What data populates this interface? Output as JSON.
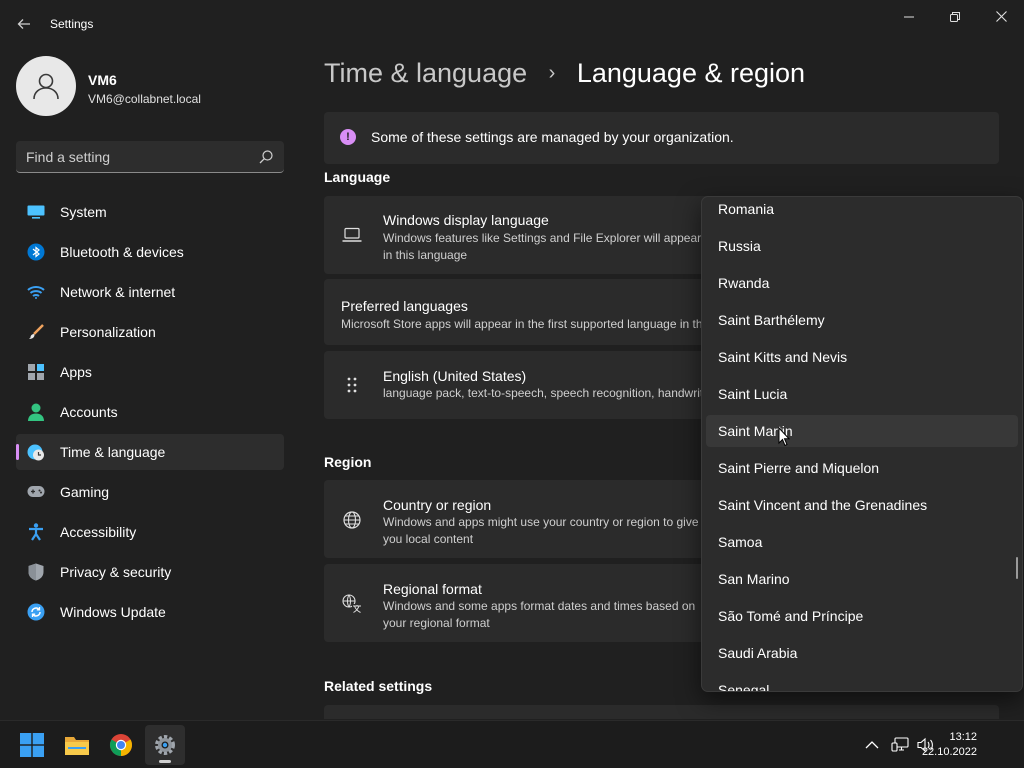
{
  "window": {
    "title": "Settings"
  },
  "profile": {
    "name": "VM6",
    "email": "VM6@collabnet.local"
  },
  "search": {
    "placeholder": "Find a setting"
  },
  "sidebar": {
    "items": [
      {
        "label": "System",
        "icon": "system-icon",
        "color": "#4cc2ff"
      },
      {
        "label": "Bluetooth & devices",
        "icon": "bluetooth-icon",
        "color": "#0078d4"
      },
      {
        "label": "Network & internet",
        "icon": "wifi-icon",
        "color": "#3aa0f3"
      },
      {
        "label": "Personalization",
        "icon": "brush-icon",
        "color": "#f0a35e"
      },
      {
        "label": "Apps",
        "icon": "apps-icon",
        "color": "#a0a6ad"
      },
      {
        "label": "Accounts",
        "icon": "person-icon",
        "color": "#33c481"
      },
      {
        "label": "Time & language",
        "icon": "globe-clock-icon",
        "color": "#4cc2ff",
        "active": true
      },
      {
        "label": "Gaming",
        "icon": "gamepad-icon",
        "color": "#a0a6ad"
      },
      {
        "label": "Accessibility",
        "icon": "accessibility-icon",
        "color": "#3aa0f3"
      },
      {
        "label": "Privacy & security",
        "icon": "shield-icon",
        "color": "#a0a6ad"
      },
      {
        "label": "Windows Update",
        "icon": "update-icon",
        "color": "#3aa0f3"
      }
    ]
  },
  "header": {
    "parent": "Time & language",
    "separator": "›",
    "current": "Language & region"
  },
  "banner": {
    "icon_glyph": "!",
    "text": "Some of these settings are managed by your organization."
  },
  "language": {
    "section_title": "Language",
    "display_language": {
      "title": "Windows display language",
      "desc": "Windows features like Settings and File Explorer will appear in this language"
    },
    "preferred": {
      "title": "Preferred languages",
      "desc": "Microsoft Store apps will appear in the first supported language in this list"
    },
    "english": {
      "title": "English (United States)",
      "desc": "language pack, text-to-speech, speech recognition, handwriting, basic typing"
    }
  },
  "region": {
    "section_title": "Region",
    "country": {
      "title": "Country or region",
      "desc": "Windows and apps might use your country or region to give you local content"
    },
    "format": {
      "title": "Regional format",
      "desc": "Windows and some apps format dates and times based on your regional format"
    }
  },
  "related": {
    "section_title": "Related settings"
  },
  "dropdown": {
    "items": [
      "Romania",
      "Russia",
      "Rwanda",
      "Saint Barthélemy",
      "Saint Kitts and Nevis",
      "Saint Lucia",
      "Saint Martin",
      "Saint Pierre and Miquelon",
      "Saint Vincent and the Grenadines",
      "Samoa",
      "San Marino",
      "São Tomé and Príncipe",
      "Saudi Arabia",
      "Senegal"
    ],
    "hovered": "Saint Martin"
  },
  "taskbar": {
    "apps": [
      "start-icon",
      "file-explorer-icon",
      "chrome-icon",
      "settings-icon"
    ],
    "time": "13:12",
    "date": "22.10.2022"
  },
  "colors": {
    "accent": "#d88ef5",
    "background": "#202020",
    "card": "#2b2b2b"
  }
}
